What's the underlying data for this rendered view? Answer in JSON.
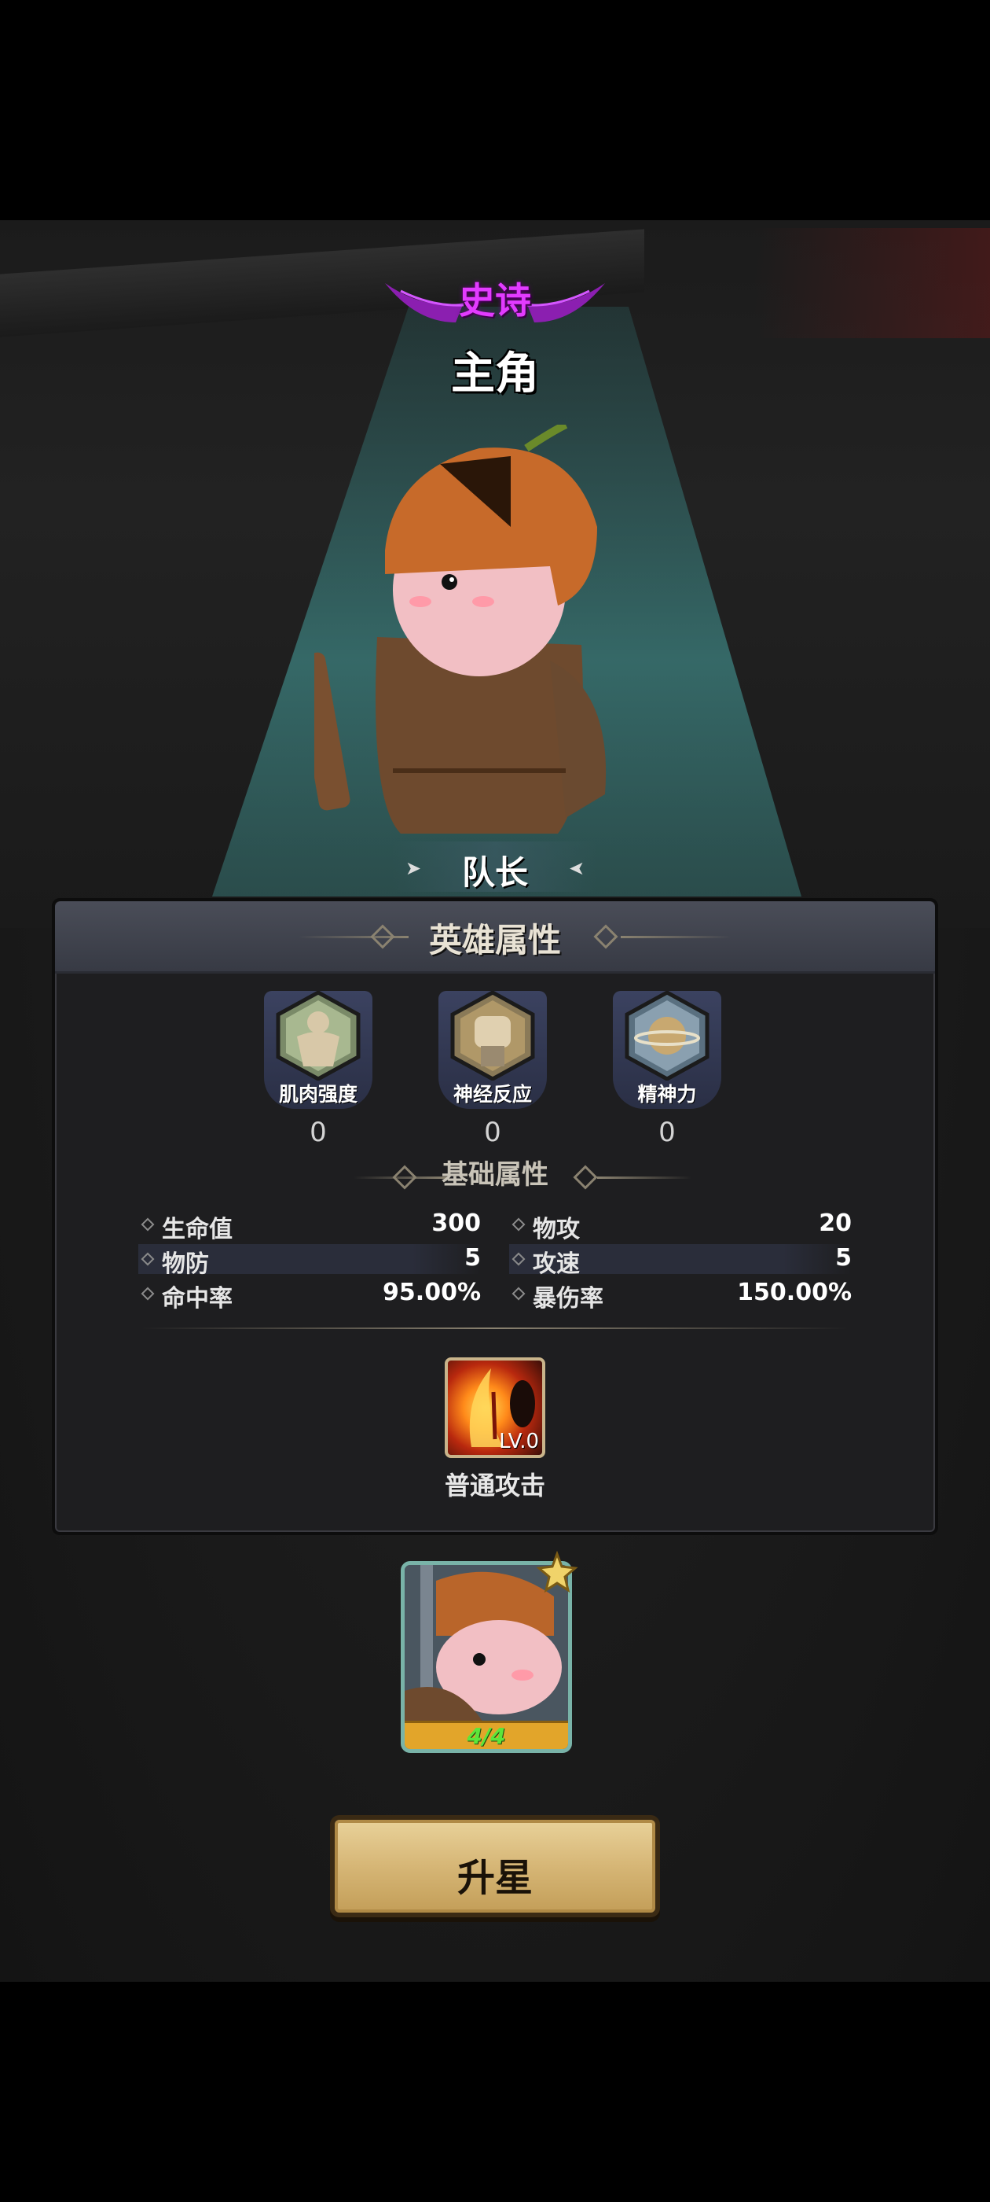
{
  "header": {
    "rarity": "史诗",
    "hero_name": "主角",
    "role": "队长"
  },
  "panel": {
    "title": "英雄属性",
    "attributes": [
      {
        "label": "肌肉强度",
        "value": "0",
        "icon": "muscle-icon"
      },
      {
        "label": "神经反应",
        "value": "0",
        "icon": "fist-icon"
      },
      {
        "label": "精神力",
        "value": "0",
        "icon": "planet-icon"
      }
    ],
    "basic_title": "基础属性",
    "stats": [
      {
        "name": "生命值",
        "value": "300"
      },
      {
        "name": "物攻",
        "value": "20"
      },
      {
        "name": "物防",
        "value": "5"
      },
      {
        "name": "攻速",
        "value": "5"
      },
      {
        "name": "命中率",
        "value": "95.00%"
      },
      {
        "name": "暴伤率",
        "value": "150.00%"
      }
    ],
    "skill": {
      "level": "LV.0",
      "name": "普通攻击",
      "icon": "fire-slash-icon"
    }
  },
  "card": {
    "fragments": "4/4",
    "badge_icon": "puzzle-piece-icon"
  },
  "button": {
    "label": "升星"
  },
  "colors": {
    "rarity": "#e23bff",
    "panel_bg": "#1e1e20",
    "button_gold": "#d6b676"
  }
}
